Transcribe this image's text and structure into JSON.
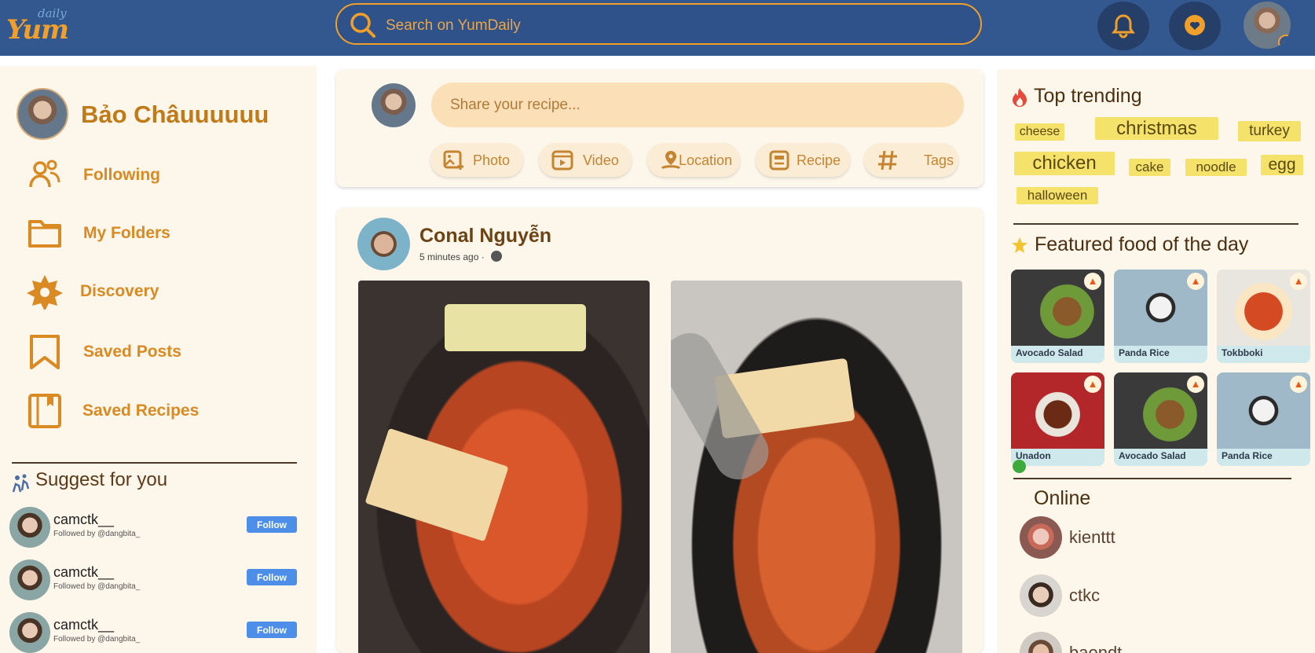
{
  "logo": {
    "main": "Yum",
    "sub": "daily"
  },
  "search": {
    "placeholder": "Search on YumDaily"
  },
  "header": {
    "icons": [
      "bell-icon",
      "heart-chat-icon",
      "user-avatar",
      "chevron-down-icon"
    ]
  },
  "profile": {
    "name": "Bảo Châuuuuuu"
  },
  "sidebar": {
    "items": [
      {
        "label": "Following",
        "icon": "people-icon"
      },
      {
        "label": "My Folders",
        "icon": "folder-icon"
      },
      {
        "label": "Discovery",
        "icon": "star-burst-icon"
      },
      {
        "label": "Saved Posts",
        "icon": "bookmark-icon"
      },
      {
        "label": "Saved Recipes",
        "icon": "book-icon"
      }
    ]
  },
  "suggest": {
    "title": "Suggest for you",
    "users": [
      {
        "name": "camctk__",
        "followed_by": "Followed by @dangbita_",
        "button": "Follow"
      },
      {
        "name": "camctk__",
        "followed_by": "Followed by @dangbita_",
        "button": "Follow"
      },
      {
        "name": "camctk__",
        "followed_by": "Followed by @dangbita_",
        "button": "Follow"
      }
    ]
  },
  "composer": {
    "placeholder": "Share your recipe...",
    "actions": [
      {
        "label": "Photo",
        "icon": "photo-add-icon"
      },
      {
        "label": "Video",
        "icon": "video-icon"
      },
      {
        "label": "Location",
        "icon": "location-icon"
      },
      {
        "label": "Recipe",
        "icon": "recipe-icon"
      },
      {
        "label": "Tags",
        "icon": "hashtag-icon"
      }
    ]
  },
  "post": {
    "author": "Conal Nguyễn",
    "time": "5 minutes ago ·",
    "privacy_icon": "globe-icon"
  },
  "trending": {
    "title": "Top trending",
    "tags": [
      "cheese",
      "christmas",
      "turkey",
      "chicken",
      "cake",
      "noodle",
      "egg",
      "halloween"
    ]
  },
  "featured": {
    "title": "Featured food of the day",
    "foods": [
      "Avocado Salad",
      "Panda Rice",
      "Tokbboki",
      "Unadon",
      "Avocado Salad",
      "Panda Rice"
    ]
  },
  "online": {
    "title": "Online",
    "users": [
      "kienttt",
      "ctkc",
      "baondt"
    ]
  },
  "colors": {
    "topbar": "#33578f",
    "accent": "#f0a02a",
    "panel": "#fdf6ea",
    "follow_button": "#4d8fe8",
    "tag": "#f4e26a",
    "online": "#3cab3c"
  }
}
